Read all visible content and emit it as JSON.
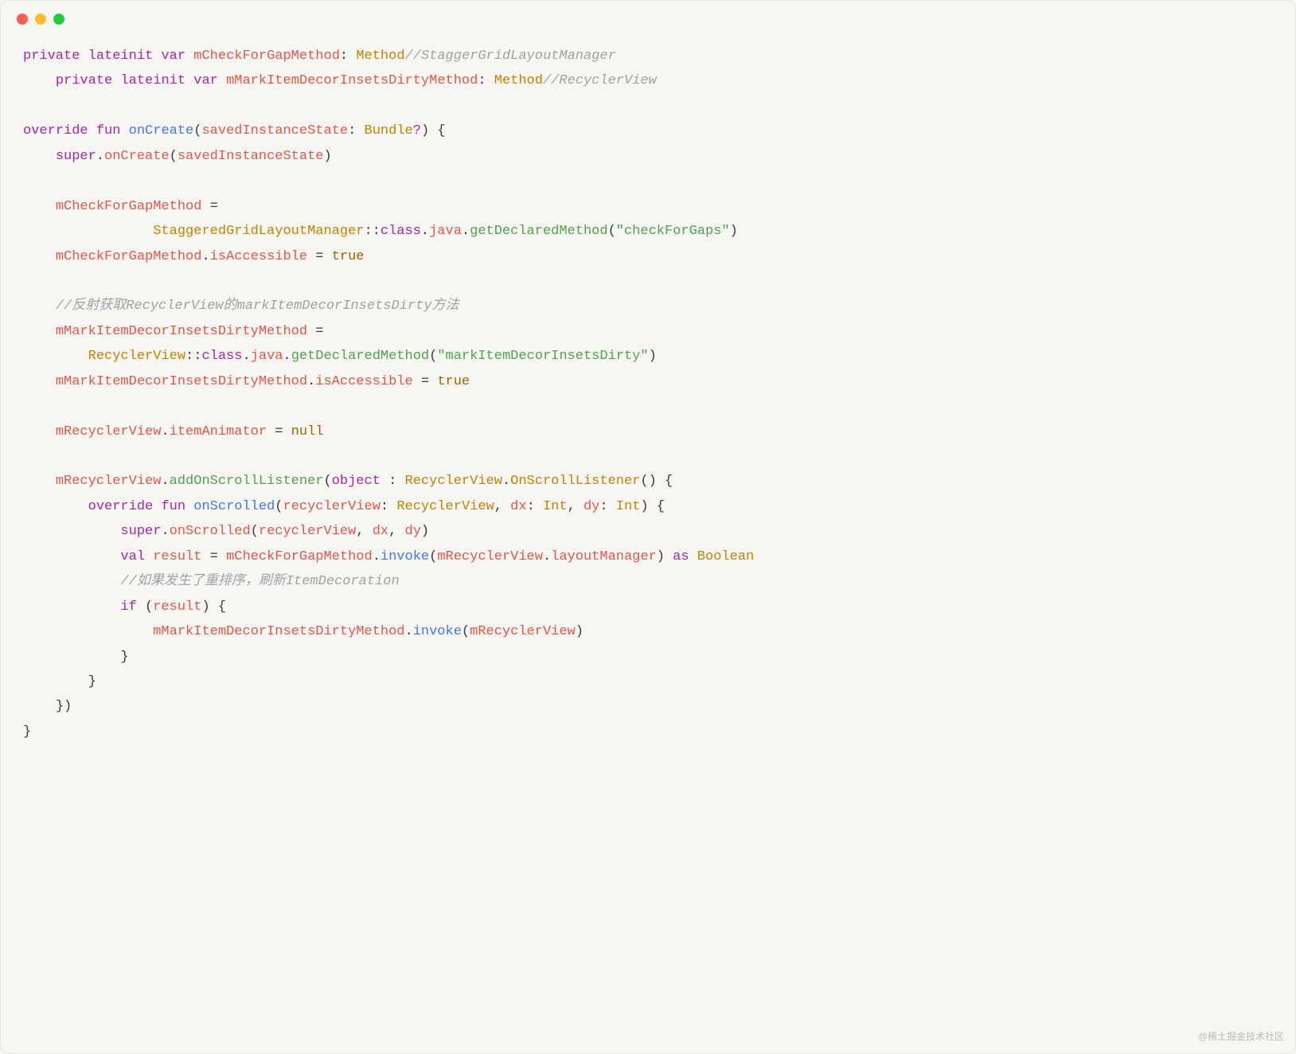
{
  "watermark": "@稀土掘金技术社区",
  "code": {
    "l1": {
      "kw_private": "private",
      "kw_lateinit": "lateinit",
      "kw_var": "var",
      "id1": "mCheckForGapMethod",
      "colon": ":",
      "type": "Method",
      "cmt": "//StaggerGridLayoutManager"
    },
    "l2": {
      "indent": "    ",
      "kw_private": "private",
      "kw_lateinit": "lateinit",
      "kw_var": "var",
      "id1": "mMarkItemDecorInsetsDirtyMethod",
      "colon": ":",
      "type": "Method",
      "cmt": "//RecyclerView"
    },
    "l4": {
      "kw_override": "override",
      "kw_fun": "fun",
      "fn": "onCreate",
      "lp": "(",
      "param": "savedInstanceState",
      "colon": ":",
      "ptype": "Bundle",
      "q": "?",
      "rp": ")",
      "lb": "{"
    },
    "l5": {
      "indent": "    ",
      "super": "super",
      "dot": ".",
      "call": "onCreate",
      "lp": "(",
      "arg": "savedInstanceState",
      "rp": ")"
    },
    "l7": {
      "indent": "    ",
      "id": "mCheckForGapMethod",
      "eq": " ="
    },
    "l8": {
      "indent": "                ",
      "cls": "StaggeredGridLayoutManager",
      "cc": "::",
      "klass": "class",
      "dot1": ".",
      "java": "java",
      "dot2": ".",
      "call": "getDeclaredMethod",
      "lp": "(",
      "str": "\"checkForGaps\"",
      "rp": ")"
    },
    "l9": {
      "indent": "    ",
      "id": "mCheckForGapMethod",
      "dot": ".",
      "prop": "isAccessible",
      "eq": " = ",
      "val": "true"
    },
    "l11": {
      "indent": "    ",
      "cmt": "//反射获取RecyclerView的markItemDecorInsetsDirty方法"
    },
    "l12": {
      "indent": "    ",
      "id": "mMarkItemDecorInsetsDirtyMethod",
      "eq": " ="
    },
    "l13": {
      "indent": "        ",
      "cls": "RecyclerView",
      "cc": "::",
      "klass": "class",
      "dot1": ".",
      "java": "java",
      "dot2": ".",
      "call": "getDeclaredMethod",
      "lp": "(",
      "str": "\"markItemDecorInsetsDirty\"",
      "rp": ")"
    },
    "l14": {
      "indent": "    ",
      "id": "mMarkItemDecorInsetsDirtyMethod",
      "dot": ".",
      "prop": "isAccessible",
      "eq": " = ",
      "val": "true"
    },
    "l16": {
      "indent": "    ",
      "id": "mRecyclerView",
      "dot": ".",
      "prop": "itemAnimator",
      "eq": " = ",
      "val": "null"
    },
    "l18": {
      "indent": "    ",
      "id": "mRecyclerView",
      "dot": ".",
      "call": "addOnScrollListener",
      "lp": "(",
      "obj": "object",
      "colon": " : ",
      "cls": "RecyclerView",
      "dot2": ".",
      "cls2": "OnScrollListener",
      "p2": "()",
      "lb": " {"
    },
    "l19": {
      "indent": "        ",
      "kw_override": "override",
      "kw_fun": "fun",
      "fn": "onScrolled",
      "lp": "(",
      "p1": "recyclerView",
      "c1": ": ",
      "t1": "RecyclerView",
      "cm1": ", ",
      "p2": "dx",
      "c2": ": ",
      "t2": "Int",
      "cm2": ", ",
      "p3": "dy",
      "c3": ": ",
      "t3": "Int",
      "rp": ")",
      "lb": " {"
    },
    "l20": {
      "indent": "            ",
      "super": "super",
      "dot": ".",
      "call": "onScrolled",
      "lp": "(",
      "a1": "recyclerView",
      "cm1": ", ",
      "a2": "dx",
      "cm2": ", ",
      "a3": "dy",
      "rp": ")"
    },
    "l21": {
      "indent": "            ",
      "kw_val": "val",
      "name": " result",
      "eq": " = ",
      "id": "mCheckForGapMethod",
      "dot": ".",
      "call": "invoke",
      "lp": "(",
      "arg": "mRecyclerView",
      "dot2": ".",
      "prop": "layoutManager",
      "rp": ")",
      "as": " as ",
      "type": "Boolean"
    },
    "l22": {
      "indent": "            ",
      "cmt": "//如果发生了重排序，刷新ItemDecoration"
    },
    "l23": {
      "indent": "            ",
      "kw_if": "if",
      "lp": " (",
      "cond": "result",
      "rp": ") ",
      "lb": "{"
    },
    "l24": {
      "indent": "                ",
      "id": "mMarkItemDecorInsetsDirtyMethod",
      "dot": ".",
      "call": "invoke",
      "lp": "(",
      "arg": "mRecyclerView",
      "rp": ")"
    },
    "l25": {
      "indent": "            ",
      "rb": "}"
    },
    "l26": {
      "indent": "        ",
      "rb": "}"
    },
    "l27": {
      "indent": "    ",
      "rb": "})"
    },
    "l28": {
      "rb": "}"
    }
  }
}
